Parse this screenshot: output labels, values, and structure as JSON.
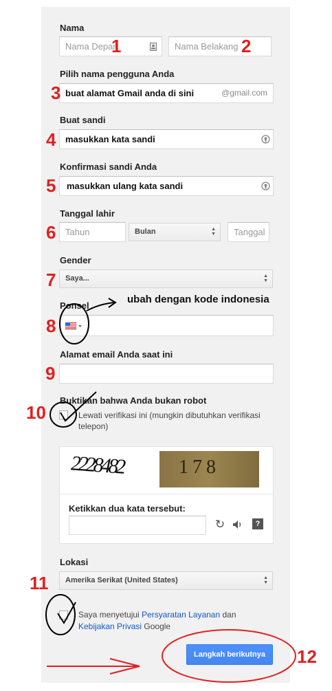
{
  "form": {
    "name_label": "Nama",
    "first_name_placeholder": "Nama Depan",
    "last_name_placeholder": "Nama Belakang",
    "username_label": "Pilih nama pengguna Anda",
    "username_value": "buat alamat Gmail anda di sini",
    "username_suffix": "@gmail.com",
    "password_label": "Buat sandi",
    "password_value": "masukkan kata sandi",
    "confirm_label": "Konfirmasi sandi Anda",
    "confirm_value": "masukkan ulang kata sandi",
    "birthday_label": "Tanggal lahir",
    "year_placeholder": "Tahun",
    "month_value": "Bulan",
    "day_placeholder": "Tanggal",
    "gender_label": "Gender",
    "gender_value": "Saya...",
    "phone_label": "Ponsel",
    "current_email_label": "Alamat email Anda saat ini",
    "robot_label": "Buktikan bahwa Anda bukan robot",
    "skip_verification": "Lewati verifikasi ini (mungkin dibutuhkan verifikasi telepon)",
    "captcha_text_1": "2228482",
    "captcha_text_2": "178",
    "captcha_prompt": "Ketikkan dua kata tersebut:",
    "location_label": "Lokasi",
    "location_value": "Amerika Serikat (United States)",
    "agree_prefix": "Saya menyetujui",
    "tos_link": "Persyaratan Layanan",
    "agree_and": "dan",
    "privacy_link": "Kebijakan Privasi",
    "agree_suffix": "Google",
    "next_button": "Langkah berikutnya"
  },
  "annotations": {
    "n1": "1",
    "n2": "2",
    "n3": "3",
    "n4": "4",
    "n5": "5",
    "n6": "6",
    "n7": "7",
    "n8": "8",
    "n9": "9",
    "n10": "10",
    "n11": "11",
    "n12": "12",
    "phone_note": "ubah dengan kode indonesia"
  },
  "colors": {
    "panel": "#f1f1f1",
    "annotation_red": "#e02020",
    "button_blue": "#4d90fe",
    "link": "#1155cc"
  }
}
